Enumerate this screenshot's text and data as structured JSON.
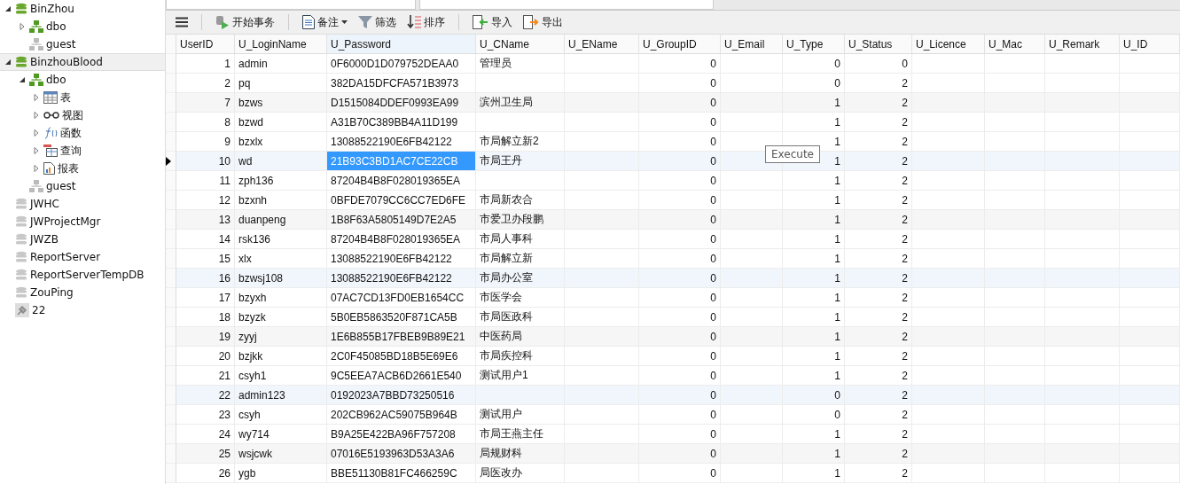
{
  "tree": [
    {
      "label": "BinZhou",
      "kind": "database",
      "open": true,
      "selected": false,
      "expanded": true,
      "children": [
        {
          "label": "dbo",
          "kind": "schema",
          "open": true,
          "selected": false,
          "expanded": false
        },
        {
          "label": "guest",
          "kind": "schema",
          "open": false,
          "selected": false
        }
      ]
    },
    {
      "label": "BinzhouBlood",
      "kind": "database",
      "open": true,
      "selected": true,
      "expanded": true,
      "children": [
        {
          "label": "dbo",
          "kind": "schema",
          "open": true,
          "selected": false,
          "expanded": true,
          "children": [
            {
              "label": "表",
              "kind": "tables",
              "open": true,
              "selected": false,
              "expanded": false
            },
            {
              "label": "视图",
              "kind": "views",
              "open": true,
              "selected": false,
              "expanded": false
            },
            {
              "label": "函数",
              "kind": "functions",
              "open": true,
              "selected": false,
              "expanded": false
            },
            {
              "label": "查询",
              "kind": "queries",
              "open": true,
              "selected": false,
              "expanded": false
            },
            {
              "label": "报表",
              "kind": "reports",
              "open": true,
              "selected": false,
              "expanded": false
            }
          ]
        },
        {
          "label": "guest",
          "kind": "schema",
          "open": false,
          "selected": false
        }
      ]
    },
    {
      "label": "JWHC",
      "kind": "database",
      "open": false,
      "selected": false
    },
    {
      "label": "JWProjectMgr",
      "kind": "database",
      "open": false,
      "selected": false
    },
    {
      "label": "JWZB",
      "kind": "database",
      "open": false,
      "selected": false
    },
    {
      "label": "ReportServer",
      "kind": "database",
      "open": false,
      "selected": false
    },
    {
      "label": "ReportServerTempDB",
      "kind": "database",
      "open": false,
      "selected": false
    },
    {
      "label": "ZouPing",
      "kind": "database",
      "open": false,
      "selected": false
    },
    {
      "label": "22",
      "kind": "connection",
      "open": false,
      "selected": false
    }
  ],
  "toolbar": [
    {
      "kind": "menu"
    },
    {
      "kind": "transaction",
      "label": "开始事务"
    },
    {
      "kind": "memo",
      "label": "备注",
      "dropdown": true
    },
    {
      "kind": "filter",
      "label": "筛选"
    },
    {
      "kind": "sort",
      "label": "排序"
    },
    {
      "kind": "import",
      "label": "导入"
    },
    {
      "kind": "export",
      "label": "导出"
    }
  ],
  "table": {
    "columns": [
      {
        "label": "UserID",
        "kind": "number",
        "selected": false
      },
      {
        "label": "U_LoginName",
        "kind": "text",
        "selected": false
      },
      {
        "label": "U_Password",
        "kind": "text",
        "selected": true
      },
      {
        "label": "U_CName",
        "kind": "text",
        "selected": false
      },
      {
        "label": "U_EName",
        "kind": "text",
        "selected": false
      },
      {
        "label": "U_GroupID",
        "kind": "number",
        "selected": false
      },
      {
        "label": "U_Email",
        "kind": "text",
        "selected": false
      },
      {
        "label": "U_Type",
        "kind": "number",
        "selected": false
      },
      {
        "label": "U_Status",
        "kind": "number",
        "selected": false
      },
      {
        "label": "U_Licence",
        "kind": "text",
        "selected": false
      },
      {
        "label": "U_Mac",
        "kind": "text",
        "selected": false
      },
      {
        "label": "U_Remark",
        "kind": "text",
        "selected": false
      },
      {
        "label": "U_ID",
        "kind": "text",
        "selected": false
      }
    ],
    "rows": [
      {
        "selected": false,
        "cells": [
          "1",
          "admin",
          "0F6000D1D079752DEAA0",
          "管理员",
          null,
          "0",
          null,
          "0",
          "0"
        ]
      },
      {
        "selected": false,
        "cells": [
          "2",
          "pq",
          "382DA15DFCFA571B3973",
          null,
          null,
          "0",
          null,
          "0",
          "2"
        ]
      },
      {
        "selected": false,
        "cells": [
          "7",
          "bzws",
          "D1515084DDEF0993EA99",
          "滨州卫生局",
          null,
          "0",
          null,
          "1",
          "2"
        ]
      },
      {
        "selected": false,
        "cells": [
          "8",
          "bzwd",
          "A31B70C389BB4A11D199",
          null,
          null,
          "0",
          null,
          "1",
          "2"
        ]
      },
      {
        "selected": false,
        "cells": [
          "9",
          "bzxlx",
          "13088522190E6FB42122",
          "市局解立新2",
          null,
          "0",
          null,
          "1",
          "2"
        ]
      },
      {
        "selected": true,
        "cells": [
          "10",
          "wd",
          "21B93C3BD1AC7CE22CB",
          "市局王丹",
          null,
          "0",
          null,
          "1",
          "2"
        ]
      },
      {
        "selected": false,
        "cells": [
          "11",
          "zph136",
          "87204B4B8F028019365EA",
          null,
          null,
          "0",
          null,
          "1",
          "2"
        ]
      },
      {
        "selected": false,
        "cells": [
          "12",
          "bzxnh",
          "0BFDE7079CC6CC7ED6FE",
          "市局新农合",
          null,
          "0",
          null,
          "1",
          "2"
        ]
      },
      {
        "selected": false,
        "cells": [
          "13",
          "duanpeng",
          "1B8F63A5805149D7E2A5",
          "市爱卫办段鹏",
          null,
          "0",
          null,
          "1",
          "2"
        ]
      },
      {
        "selected": false,
        "cells": [
          "14",
          "rsk136",
          "87204B4B8F028019365EA",
          "市局人事科",
          null,
          "0",
          null,
          "1",
          "2"
        ]
      },
      {
        "selected": false,
        "cells": [
          "15",
          "xlx",
          "13088522190E6FB42122",
          "市局解立新",
          null,
          "0",
          null,
          "1",
          "2"
        ]
      },
      {
        "selected": false,
        "cells": [
          "16",
          "bzwsj108",
          "13088522190E6FB42122",
          "市局办公室",
          null,
          "0",
          null,
          "1",
          "2"
        ]
      },
      {
        "selected": false,
        "cells": [
          "17",
          "bzyxh",
          "07AC7CD13FD0EB1654CC",
          "市医学会",
          null,
          "0",
          null,
          "1",
          "2"
        ]
      },
      {
        "selected": false,
        "cells": [
          "18",
          "bzyzk",
          "5B0EB5863520F871CA5B",
          "市局医政科",
          null,
          "0",
          null,
          "1",
          "2"
        ]
      },
      {
        "selected": false,
        "cells": [
          "19",
          "zyyj",
          "1E6B855B17FBEB9B89E21",
          "中医药局",
          null,
          "0",
          null,
          "1",
          "2"
        ]
      },
      {
        "selected": false,
        "cells": [
          "20",
          "bzjkk",
          "2C0F45085BD18B5E69E6",
          "市局疾控科",
          null,
          "0",
          null,
          "1",
          "2"
        ]
      },
      {
        "selected": false,
        "cells": [
          "21",
          "csyh1",
          "9C5EEA7ACB6D2661E540",
          "测试用户1",
          null,
          "0",
          null,
          "1",
          "2"
        ]
      },
      {
        "selected": false,
        "cells": [
          "22",
          "admin123",
          "0192023A7BBD73250516",
          null,
          null,
          "0",
          null,
          "0",
          "2"
        ]
      },
      {
        "selected": false,
        "cells": [
          "23",
          "csyh",
          "202CB962AC59075B964B",
          "测试用户",
          null,
          "0",
          null,
          "0",
          "2"
        ]
      },
      {
        "selected": false,
        "cells": [
          "24",
          "wy714",
          "B9A25E422BA96F757208",
          "市局王燕主任",
          null,
          "0",
          null,
          "1",
          "2"
        ]
      },
      {
        "selected": false,
        "cells": [
          "25",
          "wsjcwk",
          "07016E5193963D53A3A6",
          "局规财科",
          null,
          "0",
          null,
          "1",
          "2"
        ]
      },
      {
        "selected": false,
        "cells": [
          "26",
          "ygb",
          "BBE51130B81FC466259C",
          "局医改办",
          null,
          "0",
          null,
          "1",
          "2"
        ]
      }
    ]
  },
  "tooltip": "Execute"
}
